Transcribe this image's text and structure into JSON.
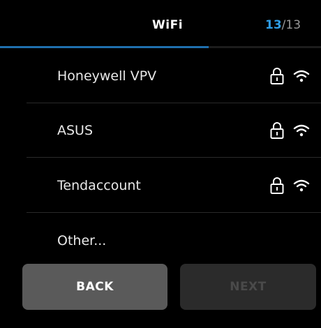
{
  "header": {
    "title": "WiFi",
    "step_current": "13",
    "step_separator": "/",
    "step_total": "13",
    "progress_fraction": 0.65
  },
  "networks": [
    {
      "name": "Honeywell VPV",
      "secured": true,
      "lock_icon": "lock-icon",
      "signal_icon": "wifi-signal-icon"
    },
    {
      "name": "ASUS",
      "secured": true,
      "lock_icon": "lock-icon",
      "signal_icon": "wifi-signal-icon"
    },
    {
      "name": "Tendaccount",
      "secured": true,
      "lock_icon": "lock-icon",
      "signal_icon": "wifi-signal-icon"
    },
    {
      "name": "Other...",
      "secured": false
    }
  ],
  "buttons": {
    "back_label": "BACK",
    "next_label": "NEXT"
  },
  "colors": {
    "background": "#000000",
    "accent": "#2e9de6",
    "progress": "#1f6fae",
    "back_button": "#5a5a5a",
    "next_button_disabled": "#2b2b2b"
  }
}
